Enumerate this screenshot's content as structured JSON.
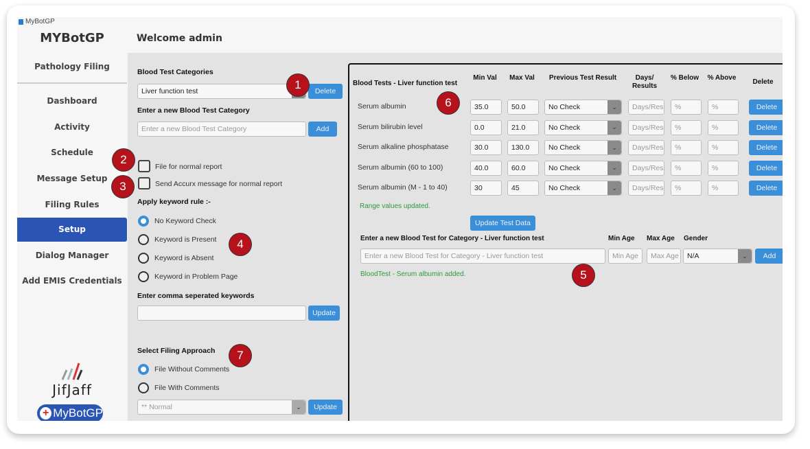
{
  "window_title": "MyBotGP",
  "brand": "MYBotGP",
  "welcome": "Welcome admin",
  "sidebar": {
    "section": "Pathology Filing",
    "items": [
      {
        "label": "Dashboard"
      },
      {
        "label": "Activity"
      },
      {
        "label": "Schedule"
      },
      {
        "label": "Message Setup"
      },
      {
        "label": "Filing Rules"
      },
      {
        "label": "Setup",
        "active": true
      },
      {
        "label": "Dialog Manager"
      },
      {
        "label": "Add EMIS Credentials"
      }
    ],
    "logo_text": "JifJaff",
    "logo_badge": "MyBotGP"
  },
  "left": {
    "categories_label": "Blood Test Categories",
    "category_value": "Liver function test",
    "delete_label": "Delete",
    "new_category_label": "Enter a new Blood Test Category",
    "new_category_placeholder": "Enter a new Blood Test Category",
    "add_label": "Add",
    "file_normal": "File for normal report",
    "send_accurx": "Send Accurx message for normal report",
    "keyword_rule_label": "Apply keyword rule :-",
    "keyword_options": [
      {
        "label": "No Keyword Check",
        "selected": true
      },
      {
        "label": "Keyword is Present"
      },
      {
        "label": "Keyword is Absent"
      },
      {
        "label": "Keyword in Problem Page"
      }
    ],
    "keywords_label": "Enter comma seperated keywords",
    "keywords_value": "",
    "update_label": "Update",
    "filing_label": "Select Filing Approach",
    "filing_options": [
      {
        "label": "File Without Comments",
        "selected": true
      },
      {
        "label": "File With Comments"
      }
    ],
    "comment_value": "** Normal",
    "update2_label": "Update"
  },
  "table": {
    "title": "Blood Tests - Liver function test",
    "headers": {
      "min": "Min Val",
      "max": "Max Val",
      "prev": "Previous Test Result",
      "days": "Days/ Results",
      "below": "% Below",
      "above": "% Above",
      "delete": "Delete"
    },
    "rows": [
      {
        "name": "Serum albumin",
        "min": "35.0",
        "max": "50.0",
        "prev": "No Check"
      },
      {
        "name": "Serum bilirubin level",
        "min": "0.0",
        "max": "21.0",
        "prev": "No Check"
      },
      {
        "name": "Serum alkaline phosphatase",
        "min": "30.0",
        "max": "130.0",
        "prev": "No Check"
      },
      {
        "name": "Serum albumin (60 to 100)",
        "min": "40.0",
        "max": "60.0",
        "prev": "No Check"
      },
      {
        "name": "Serum albumin (M - 1 to 40)",
        "min": "30",
        "max": "45",
        "prev": "No Check"
      }
    ],
    "days_placeholder": "Days/Res",
    "pct_placeholder": "%",
    "delete_label": "Delete",
    "status": "Range values updated.",
    "update_label": "Update Test Data",
    "new_test_label": "Enter a new Blood Test for Category - Liver function test",
    "new_test_placeholder": "Enter a new Blood Test for Category - Liver function test",
    "min_age_label": "Min Age",
    "max_age_label": "Max Age",
    "gender_label": "Gender",
    "min_age_placeholder": "Min Age",
    "max_age_placeholder": "Max Age",
    "gender_value": "N/A",
    "add_label": "Add",
    "added_status": "BloodTest - Serum albumin added."
  },
  "badges": [
    "1",
    "2",
    "3",
    "4",
    "5",
    "6",
    "7"
  ],
  "colors": {
    "accent": "#3b8fd9",
    "active_nav": "#2b55b5",
    "badge": "#b5121b",
    "success": "#2e9a3a"
  }
}
